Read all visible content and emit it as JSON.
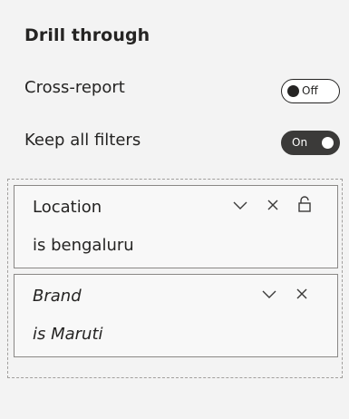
{
  "header": {
    "title": "Drill through"
  },
  "settings": {
    "cross_report": {
      "label": "Cross-report",
      "toggle_text": "Off",
      "state": "off"
    },
    "keep_all_filters": {
      "label": "Keep all filters",
      "toggle_text": "On",
      "state": "on"
    }
  },
  "filters": [
    {
      "field": "Location",
      "value": "is bengaluru",
      "italic": false,
      "icons": [
        "chevron-down-icon",
        "close-icon",
        "lock-icon"
      ]
    },
    {
      "field": "Brand",
      "value": "is Maruti",
      "italic": true,
      "icons": [
        "chevron-down-icon",
        "close-icon"
      ]
    }
  ],
  "colors": {
    "background": "#f3f3f3",
    "text": "#252423",
    "toggle_on_bg": "#3b3a39",
    "card_border": "#8a8886"
  }
}
